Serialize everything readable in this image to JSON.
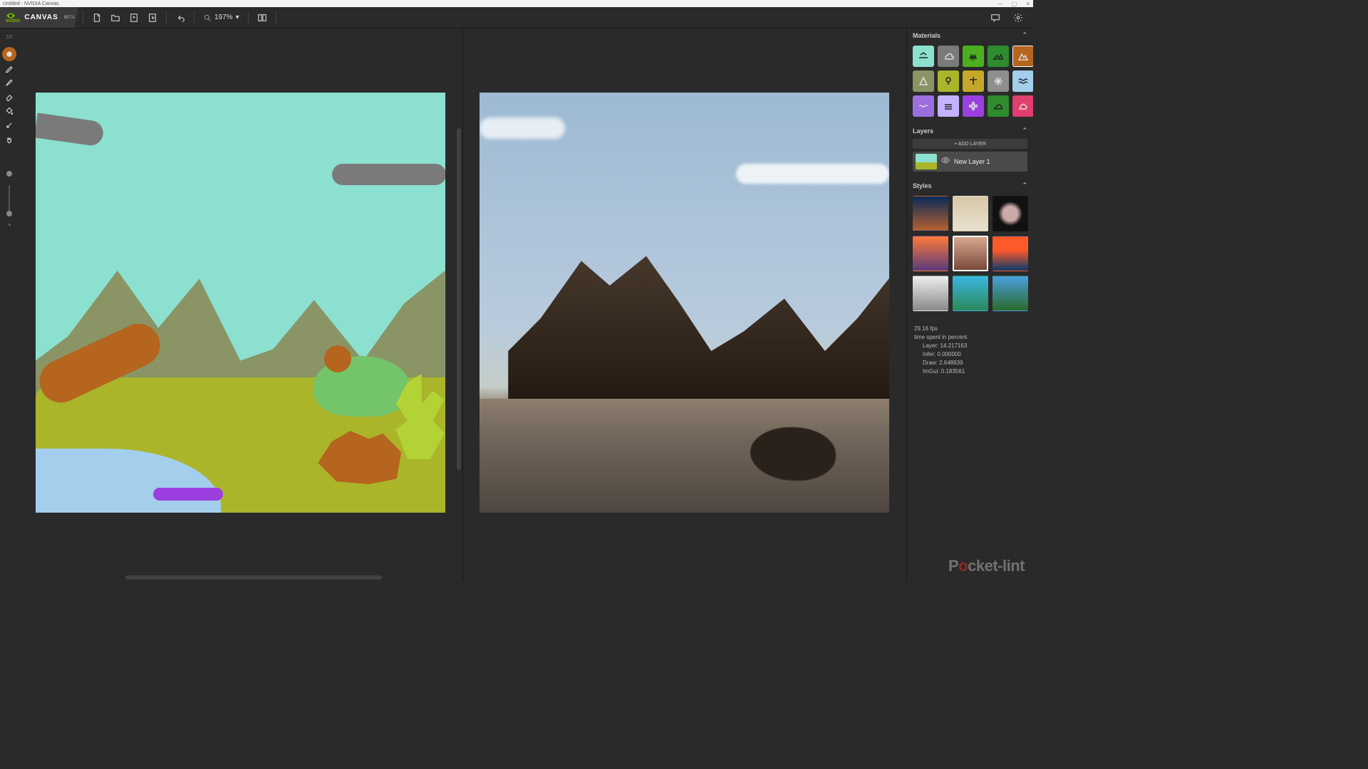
{
  "window": {
    "title": "Untitled - NVIDIA Canvas"
  },
  "brand": {
    "logo_small": "NVIDIA",
    "app": "CANVAS",
    "beta": "BETA"
  },
  "toolbar": {
    "zoom": "197%"
  },
  "tools": [
    {
      "name": "material-brush",
      "active": true,
      "icon": "mat"
    },
    {
      "name": "pencil",
      "active": false,
      "icon": "pencil"
    },
    {
      "name": "brush",
      "active": false,
      "icon": "brush"
    },
    {
      "name": "eraser",
      "active": false,
      "icon": "eraser"
    },
    {
      "name": "fill",
      "active": false,
      "icon": "fill"
    },
    {
      "name": "eyedropper",
      "active": false,
      "icon": "drop"
    },
    {
      "name": "pan",
      "active": false,
      "icon": "hand"
    }
  ],
  "panels": {
    "materials": {
      "title": "Materials",
      "items": [
        {
          "name": "sky",
          "color": "#8ce0d0",
          "icon": "sky"
        },
        {
          "name": "cloud",
          "color": "#7a7a7a",
          "icon": "cloud",
          "dark": true
        },
        {
          "name": "grass",
          "color": "#4caf1f",
          "icon": "grass"
        },
        {
          "name": "hill",
          "color": "#2e8b2e",
          "icon": "hill"
        },
        {
          "name": "mountain",
          "color": "#b5651d",
          "icon": "mtn",
          "selected": true,
          "dark": true
        },
        {
          "name": "sand",
          "color": "#8a9465",
          "icon": "tri",
          "dark": true
        },
        {
          "name": "tree",
          "color": "#aab52a",
          "icon": "tree"
        },
        {
          "name": "palm",
          "color": "#c5a82a",
          "icon": "palm"
        },
        {
          "name": "snow",
          "color": "#8e8e8e",
          "icon": "snow",
          "dark": true
        },
        {
          "name": "water",
          "color": "#a3ceec",
          "icon": "water"
        },
        {
          "name": "sea",
          "color": "#9c6fe0",
          "icon": "waves",
          "dark": true
        },
        {
          "name": "fog",
          "color": "#c6b3ff",
          "icon": "fog"
        },
        {
          "name": "flower",
          "color": "#9c3fe0",
          "icon": "flower",
          "dark": true
        },
        {
          "name": "bush",
          "color": "#2e8b2e",
          "icon": "bush"
        },
        {
          "name": "rock",
          "color": "#e03f6f",
          "icon": "rock",
          "dark": true
        }
      ]
    },
    "layers": {
      "title": "Layers",
      "add_label": "+ ADD LAYER",
      "items": [
        {
          "name": "New Layer 1"
        }
      ]
    },
    "styles": {
      "title": "Styles",
      "items": [
        {
          "name": "style-night-desert",
          "bg": "linear-gradient(#0a2a5a,#b56030)"
        },
        {
          "name": "style-clouds",
          "bg": "linear-gradient(#d8c8a8,#e8e0d0)"
        },
        {
          "name": "style-cave",
          "bg": "radial-gradient(circle at 50% 50%,#caa 30%,#111 50%)"
        },
        {
          "name": "style-sunset",
          "bg": "linear-gradient(#ff7a3a,#5a3a7a)"
        },
        {
          "name": "style-peak",
          "bg": "linear-gradient(#d8a890,#7a4a3a)",
          "selected": true
        },
        {
          "name": "style-ocean-dusk",
          "bg": "linear-gradient(#ff5a2a 40%,#0a3a6a)"
        },
        {
          "name": "style-bw-mtn",
          "bg": "linear-gradient(#eee,#888)"
        },
        {
          "name": "style-tropical",
          "bg": "linear-gradient(#3ab6e0,#2a8a5a)"
        },
        {
          "name": "style-alpine",
          "bg": "linear-gradient(#4aa0e0,#2a6a2a)"
        }
      ]
    }
  },
  "stats": {
    "fps": "29.16 fps",
    "header": "time spent in percent",
    "rows": [
      {
        "label": "Layer:",
        "value": "14.217163"
      },
      {
        "label": "Infer:",
        "value": "0.000000"
      },
      {
        "label": "Draw:",
        "value": "2.648939"
      },
      {
        "label": "ImGui:",
        "value": "0.183561"
      }
    ]
  },
  "watermark": {
    "pre": "P",
    "o": "o",
    "post": "cket-lint"
  }
}
